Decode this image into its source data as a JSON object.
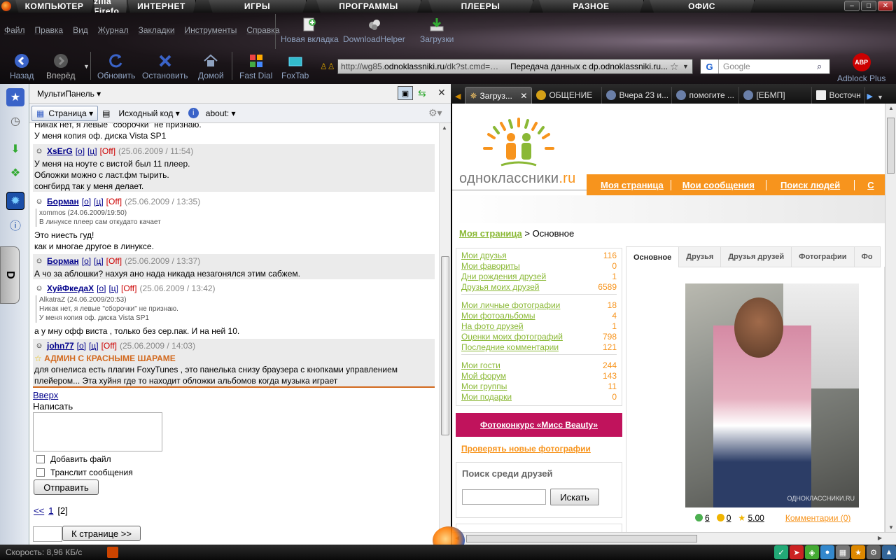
{
  "taskbar": {
    "tasks": [
      "КОМПЬЮТЕР",
      "zilla Firefo",
      "ИНТЕРНЕТ",
      "ИГРЫ",
      "ПРОГРАММЫ",
      "ПЛЕЕРЫ",
      "РАЗНОЕ",
      "ОФИС"
    ]
  },
  "menu": [
    "Файл",
    "Правка",
    "Вид",
    "Журнал",
    "Закладки",
    "Инструменты",
    "Справка"
  ],
  "toolbar_top": {
    "new_tab": "Новая вкладка",
    "download_helper": "DownloadHelper",
    "downloads": "Загрузки"
  },
  "toolbar_nav": {
    "back": "Назад",
    "forward": "Вперёд",
    "refresh": "Обновить",
    "stop": "Остановить",
    "home": "Домой",
    "fast_dial": "Fast Dial",
    "foxtab": "FoxTab",
    "adblock": "Adblock Plus",
    "adblock_badge": "ABP"
  },
  "urlbar": {
    "url_prefix": "http://wg85.",
    "url_domain": "odnoklassniki.ru",
    "url_suffix": "/dk?st.cmd=…",
    "status": "Передача данных с dp.odnoklassniki.ru..."
  },
  "searchbar": {
    "engine": "G",
    "placeholder": "Google"
  },
  "multipanel": {
    "title": "МультиПанель",
    "page_btn": "Страница",
    "source_btn": "Исходный код",
    "about_btn": "about:",
    "posts": [
      {
        "lines": [
          "Никак нет, я левые \"сборочки\" не признаю.",
          "У меня копия оф. диска Vista SP1"
        ]
      },
      {
        "user": "XsErG",
        "o": "[о]",
        "c": "[ц]",
        "off": "[Off]",
        "date": "(25.06.2009 / 11:54)",
        "lines": [
          "У меня на ноуте с вистой был 11 плеер.",
          "Обложки можно с ласт.фм тырить.",
          "сонгбирд так у меня делает."
        ]
      },
      {
        "user": "Борман",
        "o": "[о]",
        "c": "[ц]",
        "off": "[Off]",
        "date": "(25.06.2009 / 13:35)",
        "quote": [
          "xommos (24.06.2009/19:50)",
          "В линуксе плеер сам откудато качает"
        ],
        "lines": [
          "Это ниесть гуд!",
          "как и многае другое в линуксе."
        ]
      },
      {
        "user": "Борман",
        "o": "[о]",
        "c": "[ц]",
        "off": "[Off]",
        "date": "(25.06.2009 / 13:37)",
        "lines": [
          "А чо за аблошки? нахуя ано нада никада незагонялся этим сабжем."
        ]
      },
      {
        "user": "ХуйФкедаХ",
        "o": "[о]",
        "c": "[ц]",
        "off": "[Off]",
        "date": "(25.06.2009 / 13:42)",
        "quote": [
          "AlkatraZ (24.06.2009/20:53)",
          "Никак нет, я левые \"сборочки\" не признаю.",
          "У меня копия оф. диска Vista SP1"
        ],
        "lines": [
          "а у мну офф виста , только без сер.пак. И на ней 10."
        ]
      },
      {
        "user": "john77",
        "o": "[о]",
        "c": "[ц]",
        "off": "[Off]",
        "date": "(25.06.2009 / 14:03)",
        "status": "АДМИН С КРАСНЫМЕ ШАРАМЕ",
        "lines": [
          "для огнелиса есть плагин FoxyTunes , это панелька снизу браузера с кнопками управлением",
          "плейером... Эта хуйня где то находит обложки альбомов когда музыка играет"
        ]
      }
    ],
    "up_link": "Вверх",
    "write_label": "Написать",
    "attach_label": "Добавить файл",
    "translit_label": "Транслит сообщения",
    "send_btn": "Отправить",
    "pager_prev": "<<",
    "pager_p1": "1",
    "pager_p2": "[2]",
    "goto_btn": "К странице >>"
  },
  "tabs": [
    "Загруз...",
    "ОБЩЕНИЕ",
    "Вчера 23 и...",
    "помогите ...",
    "[ЕБМП]",
    "Восточн"
  ],
  "site": {
    "logo_main": "одноклассники",
    "logo_tld": ".ru",
    "nav": [
      "Моя страница",
      "Мои сообщения",
      "Поиск людей",
      "С"
    ],
    "crumb_link": "Моя страница",
    "crumb_rest": "> Основное",
    "stats": [
      {
        "label": "Мои друзья",
        "n": "116"
      },
      {
        "label": "Мои фавориты",
        "n": "0"
      },
      {
        "label": "Дни рождения друзей",
        "n": "1"
      },
      {
        "label": "Друзья моих друзей",
        "n": "6589"
      },
      {
        "label": "Мои личные фотографии",
        "n": "18"
      },
      {
        "label": "Мои фотоальбомы",
        "n": "4"
      },
      {
        "label": "На фото друзей",
        "n": "1"
      },
      {
        "label": "Оценки моих фотографий",
        "n": "798"
      },
      {
        "label": "Последние комментарии",
        "n": "121"
      },
      {
        "label": "Мои гости",
        "n": "244"
      },
      {
        "label": "Мой форум",
        "n": "143"
      },
      {
        "label": "Мои группы",
        "n": "11"
      },
      {
        "label": "Мои подарки",
        "n": "0"
      }
    ],
    "contest": "Фотоконкурс «Мисс Beauty»",
    "check_new": "Проверять новые фотографии",
    "search_title": "Поиск среди друзей",
    "search_btn": "Искать",
    "profile_tabs": [
      "Основное",
      "Друзья",
      "Друзья друзей",
      "Фотографии",
      "Фо"
    ],
    "photo_watermark": "ОДНОКЛАССНИКИ.RU",
    "rating": {
      "green": "6",
      "yellow": "0",
      "score": "5.00"
    },
    "comments": "Комментарии (0)"
  },
  "statusbar": {
    "speed": "Скорость: 8,96 КБ/с"
  },
  "colors": {
    "ok_orange": "#f7941d",
    "ok_green": "#8ab835",
    "contest": "#c0135c"
  }
}
